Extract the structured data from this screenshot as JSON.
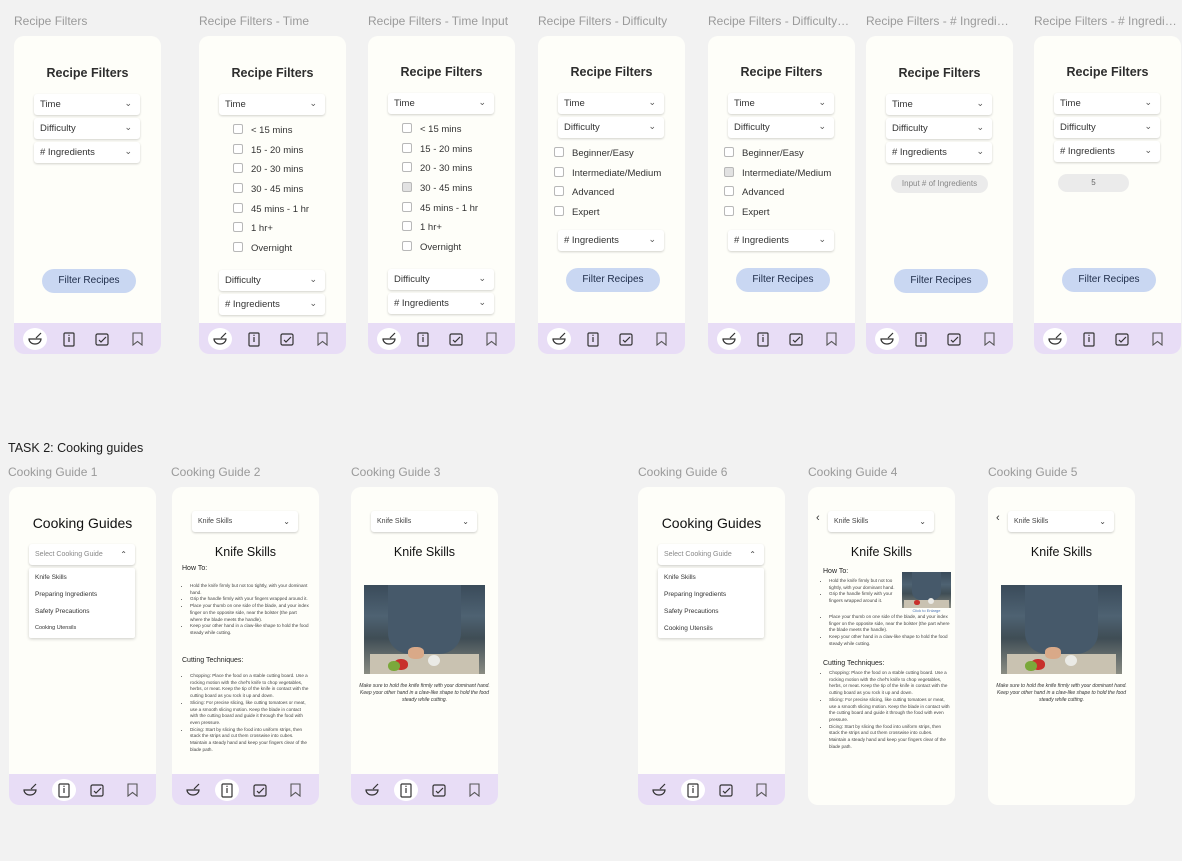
{
  "frame_labels": [
    "Recipe Filters",
    "Recipe Filters - Time",
    "Recipe Filters - Time Input",
    "Recipe Filters - Difficulty",
    "Recipe Filters - Difficulty Input",
    "Recipe Filters - # Ingredients",
    "Recipe Filters - # Ingredients Input"
  ],
  "task_label": "TASK 2: Cooking guides",
  "guide_labels": [
    "Cooking Guide 1",
    "Cooking Guide 2",
    "Cooking Guide 3",
    "Cooking Guide 6",
    "Cooking Guide 4",
    "Cooking Guide 5"
  ],
  "filters": {
    "title": "Recipe Filters",
    "time": "Time",
    "difficulty": "Difficulty",
    "ingredients": "# Ingredients",
    "filter_button": "Filter Recipes",
    "time_options": [
      "< 15 mins",
      "15 - 20 mins",
      "20 - 30 mins",
      "30 - 45 mins",
      "45 mins - 1 hr",
      "1 hr+",
      "Overnight"
    ],
    "difficulty_options": [
      "Beginner/Easy",
      "Intermediate/Medium",
      "Advanced",
      "Expert"
    ],
    "ingredients_placeholder": "Input # of Ingredients",
    "ingredients_value": "5",
    "time_selected_index": 3,
    "difficulty_selected_index": 1
  },
  "guides": {
    "title": "Cooking Guides",
    "select_placeholder": "Select Cooking Guide",
    "menu": [
      "Knife Skills",
      "Preparing Ingredients",
      "Safety Precautions",
      "Cooking Utensils"
    ],
    "selected": "Knife Skills",
    "page_title": "Knife Skills",
    "how_to": "How To:",
    "how_to_items": [
      "Hold the knife firmly but not too tightly, with your dominant hand.",
      "Grip the handle firmly with your fingers wrapped around it.",
      "Place your thumb on one side of the blade, and your index finger on the opposite side, near the bolster (the part where the blade meets the handle).",
      "Keep your other hand in a claw-like shape to hold the food steady while cutting."
    ],
    "cutting": "Cutting Techniques:",
    "cutting_items": [
      "Chopping: Place the food on a stable cutting board. Use a rocking motion with the chef's knife to chop vegetables, herbs, or meat. Keep the tip of the knife in contact with the cutting board as you rock it up and down.",
      "Slicing: For precise slicing, like cutting tomatoes or meat, use a smooth slicing motion. Keep the blade in contact with the cutting board and guide it through the food with even pressure.",
      "Dicing: Start by slicing the food into uniform strips, then stack the strips and cut them crosswise into cubes. Maintain a steady hand and keep your fingers clear of the blade path."
    ],
    "caption": "Make sure to hold the knife firmly with your dominant hand. Keep your other hand in a claw-like shape to hold the food steady while cutting.",
    "enlarge": "Click to Enlarge"
  },
  "nav_icons": [
    "chef-bowl-icon",
    "recipe-book-icon",
    "checklist-icon",
    "bookmark-icon"
  ],
  "colors": {
    "nav_bg": "#e8ddf6",
    "button_bg": "#c9d7f2",
    "phone_bg": "#fefef9",
    "canvas_bg": "#f2f2f2"
  }
}
